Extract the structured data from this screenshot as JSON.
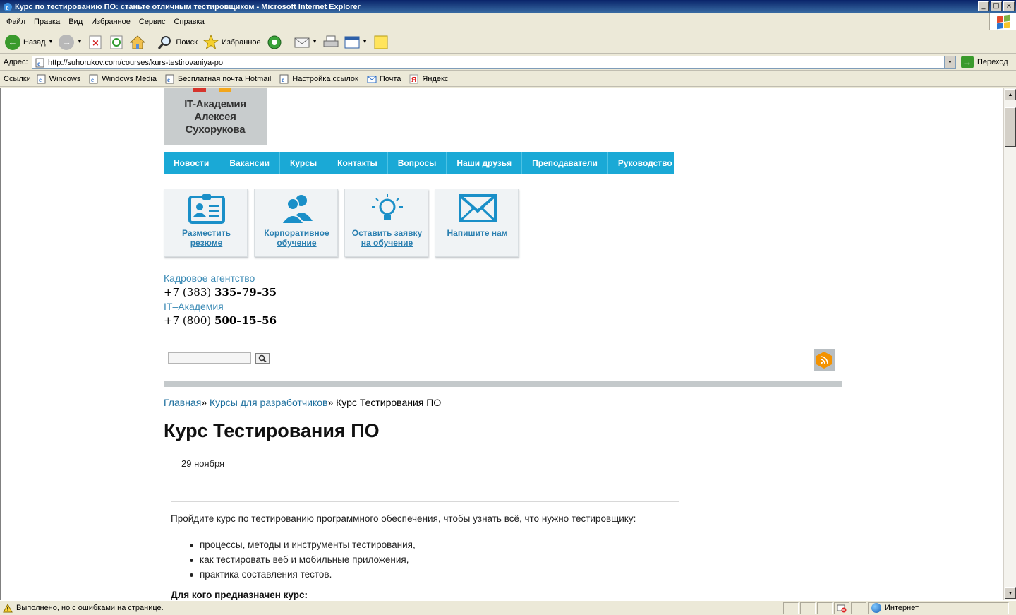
{
  "window": {
    "title": "Курс по тестированию ПО: станьте отличным тестировщиком - Microsoft Internet Explorer",
    "controls": [
      "_",
      "□",
      "×"
    ]
  },
  "menu": [
    "Файл",
    "Правка",
    "Вид",
    "Избранное",
    "Сервис",
    "Справка"
  ],
  "toolbar": {
    "back": "Назад",
    "search": "Поиск",
    "favorites": "Избранное"
  },
  "address": {
    "label": "Адрес:",
    "url": "http://suhorukov.com/courses/kurs-testirovaniya-po",
    "go": "Переход"
  },
  "links": {
    "label": "Ссылки",
    "items": [
      "Windows",
      "Windows Media",
      "Бесплатная почта Hotmail",
      "Настройка ссылок",
      "Почта",
      "Яндекс"
    ]
  },
  "site": {
    "logo_line1": "IT-Академия",
    "logo_line2": "Алексея Сухорукова",
    "nav": [
      "Новости",
      "Вакансии",
      "Курсы",
      "Контакты",
      "Вопросы",
      "Наши друзья",
      "Преподаватели",
      "Руководство"
    ],
    "tiles": [
      {
        "l1": "Разместить",
        "l2": "резюме"
      },
      {
        "l1": "Корпоративное",
        "l2": "обучение"
      },
      {
        "l1": "Оставить заявку",
        "l2": "на обучение"
      },
      {
        "l1": "Напишите нам",
        "l2": ""
      }
    ],
    "contacts": {
      "label1": "Кадровое агентство",
      "code1": "+7 (383) ",
      "num1": "335–79–35",
      "label2": "IT–Академия",
      "code2": "+7 (800) ",
      "num2": "500–15–56"
    },
    "search_value": ""
  },
  "page": {
    "breadcrumb_home": "Главная",
    "breadcrumb_sep1": "» ",
    "breadcrumb_section": "Курсы для разработчиков",
    "breadcrumb_sep2": "» ",
    "breadcrumb_current": "Курс Тестирования ПО",
    "title": "Курс Тестирования ПО",
    "date": "29 ноября",
    "intro": "Пройдите курс по тестированию программного обеспечения, чтобы узнать всё, что нужно тестировщику:",
    "bullets": [
      "процессы, методы и инструменты тестирования,",
      "как тестировать веб и мобильные приложения,",
      "практика составления тестов."
    ],
    "for_whom": "Для кого предназначен курс:"
  },
  "status": {
    "text": "Выполнено, но с ошибками на странице.",
    "zone": "Интернет"
  },
  "colors": {
    "nav_bg": "#1aa9d6",
    "link": "#1d6f9e",
    "tile_label": "#2a7fb0",
    "rss": "#f39200"
  }
}
